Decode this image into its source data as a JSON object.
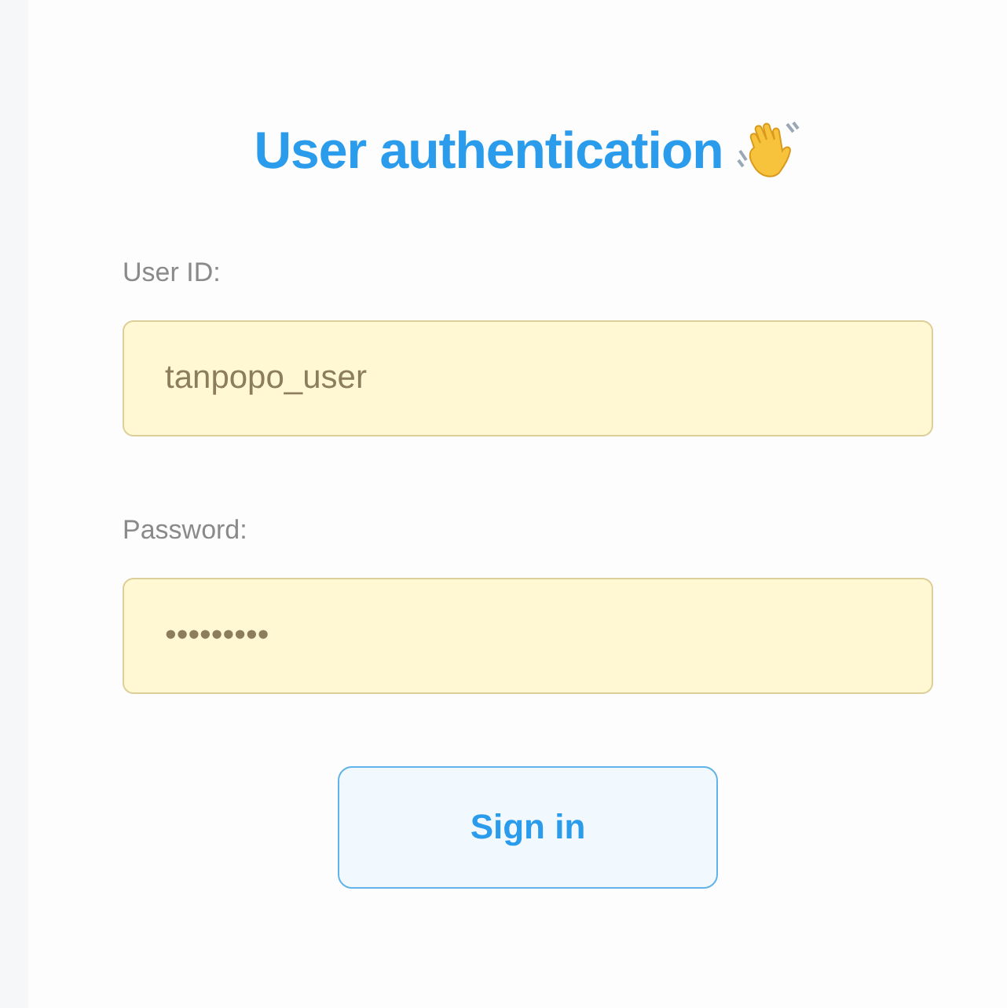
{
  "title": "User authentication",
  "fields": [
    {
      "label": "User ID:",
      "value": "tanpopo_user"
    },
    {
      "label": "Password:",
      "value": "•••••••••"
    }
  ],
  "button": "Sign in"
}
